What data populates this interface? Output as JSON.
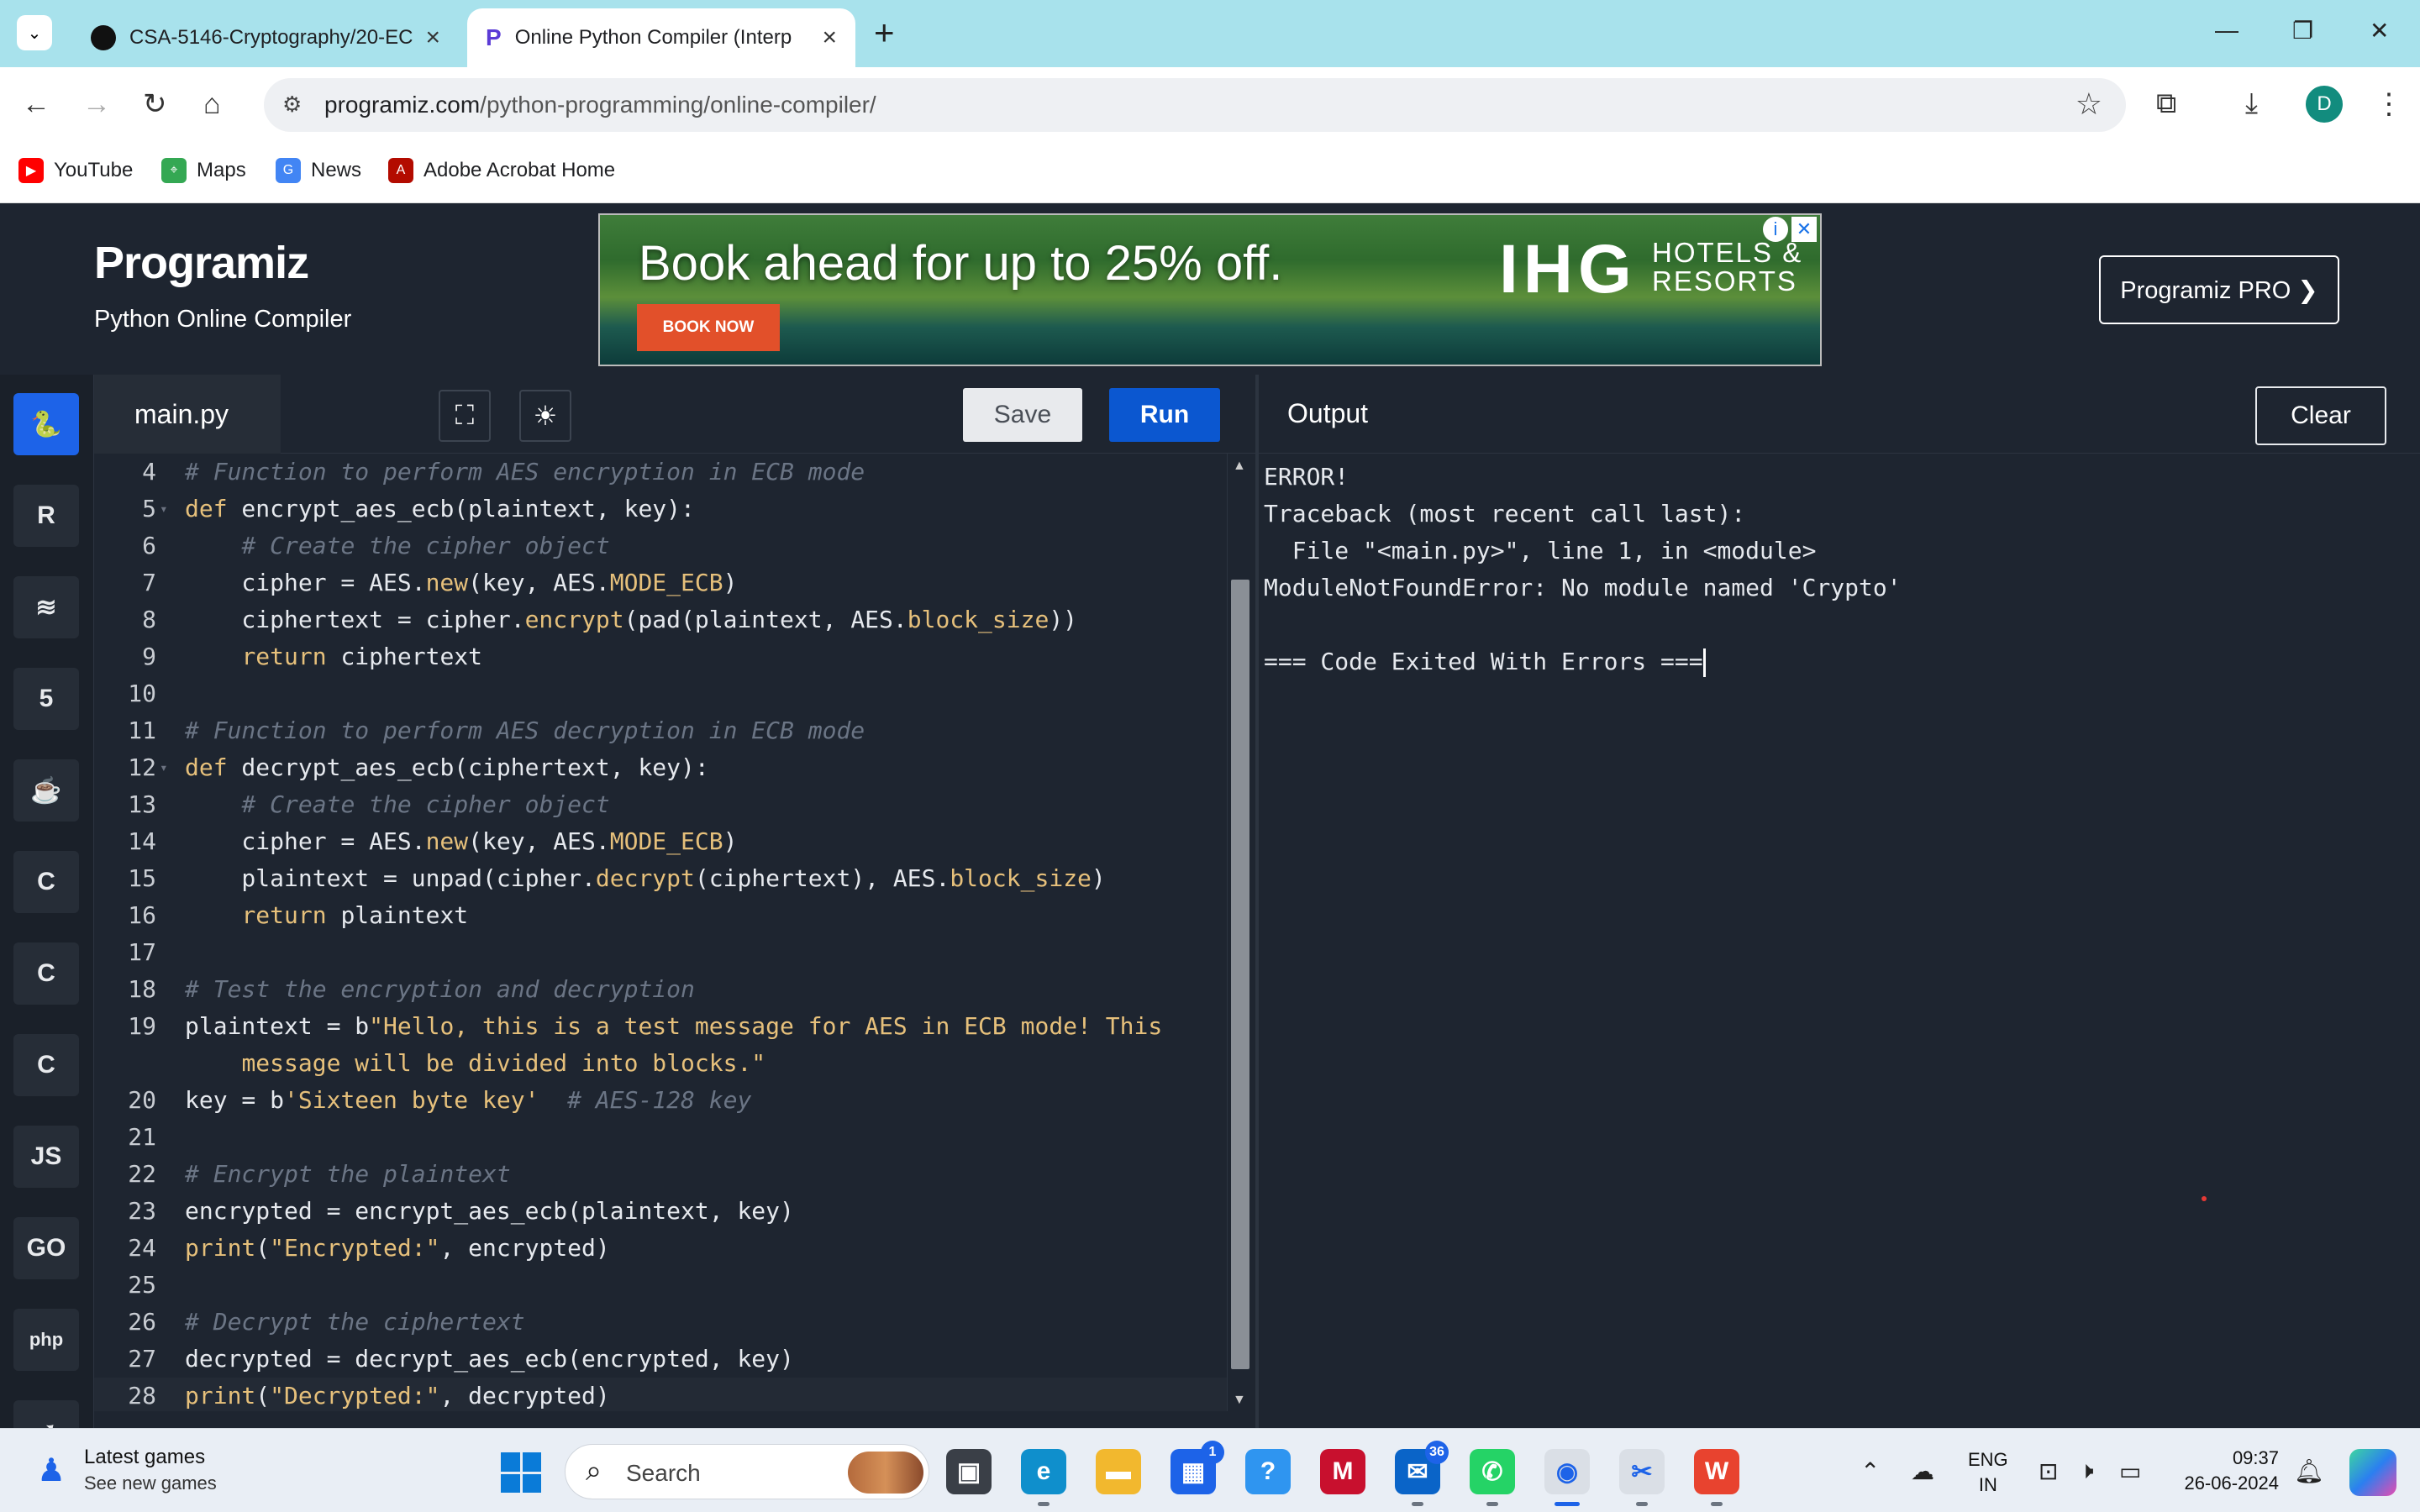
{
  "browser": {
    "tabs": [
      {
        "title": "CSA-5146-Cryptography/20-EC",
        "icon": "github-icon",
        "active": false
      },
      {
        "title": "Online Python Compiler (Interp",
        "icon": "programiz-icon",
        "active": true
      }
    ],
    "url_host": "programiz.com",
    "url_path": "/python-programming/online-compiler/",
    "profile_initial": "D",
    "bookmarks": [
      {
        "label": "YouTube",
        "icon": "youtube-icon",
        "color": "#ff0000"
      },
      {
        "label": "Maps",
        "icon": "maps-icon",
        "color": "#34a853"
      },
      {
        "label": "News",
        "icon": "news-icon",
        "color": "#4285f4"
      },
      {
        "label": "Adobe Acrobat Home",
        "icon": "acrobat-icon",
        "color": "#b30b00"
      }
    ]
  },
  "site": {
    "logo": "Programiz",
    "subtitle": "Python Online Compiler",
    "pro_button": "Programiz PRO ❯",
    "ad": {
      "headline": "Book ahead for up to 25% off.",
      "cta": "BOOK NOW",
      "brand": "IHG",
      "brand_line1": "HOTELS &",
      "brand_line2": "RESORTS"
    }
  },
  "sidebar": {
    "languages": [
      {
        "name": "python",
        "glyph": "🐍",
        "active": true
      },
      {
        "name": "r",
        "glyph": "R"
      },
      {
        "name": "sql",
        "glyph": "≋"
      },
      {
        "name": "html",
        "glyph": "5"
      },
      {
        "name": "java",
        "glyph": "☕"
      },
      {
        "name": "c",
        "glyph": "C"
      },
      {
        "name": "cpp",
        "glyph": "C"
      },
      {
        "name": "csharp",
        "glyph": "C"
      },
      {
        "name": "javascript",
        "glyph": "JS"
      },
      {
        "name": "go",
        "glyph": "GO"
      },
      {
        "name": "php",
        "glyph": "php"
      },
      {
        "name": "swift",
        "glyph": "➶"
      },
      {
        "name": "rust",
        "glyph": "⚙"
      }
    ]
  },
  "editor": {
    "file_name": "main.py",
    "save_label": "Save",
    "run_label": "Run",
    "lines": [
      {
        "n": "4",
        "fold": false,
        "html": "<span class='t-cm'># Function to perform AES encryption in ECB mode</span>"
      },
      {
        "n": "5",
        "fold": true,
        "html": "<span class='t-kw'>def</span> encrypt_aes_ecb(plaintext, key):"
      },
      {
        "n": "6",
        "fold": false,
        "html": "    <span class='t-cm'># Create the cipher object</span>"
      },
      {
        "n": "7",
        "fold": false,
        "html": "    cipher = AES.<span class='t-fn'>new</span>(key, AES.<span class='t-fn'>MODE_ECB</span>)"
      },
      {
        "n": "8",
        "fold": false,
        "html": "    ciphertext = cipher.<span class='t-fn'>encrypt</span>(pad(plaintext, AES.<span class='t-fn'>block_size</span>))"
      },
      {
        "n": "9",
        "fold": false,
        "html": "    <span class='t-kw'>return</span> ciphertext"
      },
      {
        "n": "10",
        "fold": false,
        "html": ""
      },
      {
        "n": "11",
        "fold": false,
        "html": "<span class='t-cm'># Function to perform AES decryption in ECB mode</span>"
      },
      {
        "n": "12",
        "fold": true,
        "html": "<span class='t-kw'>def</span> decrypt_aes_ecb(ciphertext, key):"
      },
      {
        "n": "13",
        "fold": false,
        "html": "    <span class='t-cm'># Create the cipher object</span>"
      },
      {
        "n": "14",
        "fold": false,
        "html": "    cipher = AES.<span class='t-fn'>new</span>(key, AES.<span class='t-fn'>MODE_ECB</span>)"
      },
      {
        "n": "15",
        "fold": false,
        "html": "    plaintext = unpad(cipher.<span class='t-fn'>decrypt</span>(ciphertext), AES.<span class='t-fn'>block_size</span>)"
      },
      {
        "n": "16",
        "fold": false,
        "html": "    <span class='t-kw'>return</span> plaintext"
      },
      {
        "n": "17",
        "fold": false,
        "html": ""
      },
      {
        "n": "18",
        "fold": false,
        "html": "<span class='t-cm'># Test the encryption and decryption</span>"
      },
      {
        "n": "19",
        "fold": false,
        "html": "plaintext = b<span class='t-str'>\"Hello, this is a test message for AES in ECB mode! This</span>"
      },
      {
        "n": "",
        "fold": false,
        "html": "    <span class='t-str'>message will be divided into blocks.\"</span>"
      },
      {
        "n": "20",
        "fold": false,
        "html": "key = b<span class='t-str'>'Sixteen byte key'</span>  <span class='t-cm'># AES-128 key</span>"
      },
      {
        "n": "21",
        "fold": false,
        "html": ""
      },
      {
        "n": "22",
        "fold": false,
        "html": "<span class='t-cm'># Encrypt the plaintext</span>"
      },
      {
        "n": "23",
        "fold": false,
        "html": "encrypted = encrypt_aes_ecb(plaintext, key)"
      },
      {
        "n": "24",
        "fold": false,
        "html": "<span class='t-kw'>print</span>(<span class='t-str'>\"Encrypted:\"</span>, encrypted)"
      },
      {
        "n": "25",
        "fold": false,
        "html": ""
      },
      {
        "n": "26",
        "fold": false,
        "html": "<span class='t-cm'># Decrypt the ciphertext</span>"
      },
      {
        "n": "27",
        "fold": false,
        "html": "decrypted = decrypt_aes_ecb(encrypted, key)"
      },
      {
        "n": "28",
        "fold": false,
        "html": "<span class='t-kw'>print</span>(<span class='t-str'>\"Decrypted:\"</span>, decrypted)",
        "current": true
      }
    ]
  },
  "output": {
    "title": "Output",
    "clear_label": "Clear",
    "lines": [
      "ERROR!",
      "Traceback (most recent call last):",
      "  File \"<main.py>\", line 1, in <module>",
      "ModuleNotFoundError: No module named 'Crypto'",
      "",
      "=== Code Exited With Errors ==="
    ]
  },
  "taskbar": {
    "widget_title": "Latest games",
    "widget_sub": "See new games",
    "search_placeholder": "Search",
    "apps": [
      {
        "name": "task-view",
        "glyph": "▣",
        "bg": "#3a3f47",
        "running": false
      },
      {
        "name": "edge",
        "glyph": "e",
        "bg": "#0f8fcc",
        "running": true
      },
      {
        "name": "file-explorer",
        "glyph": "▬",
        "bg": "#f2b82e",
        "running": false
      },
      {
        "name": "microsoft-store",
        "glyph": "▦",
        "bg": "#1d63e8",
        "badge": "1"
      },
      {
        "name": "help",
        "glyph": "?",
        "bg": "#2f95f0",
        "running": false
      },
      {
        "name": "mcafee",
        "glyph": "M",
        "bg": "#c8102e",
        "running": false
      },
      {
        "name": "outlook",
        "glyph": "✉",
        "bg": "#0a64c8",
        "badge": "36",
        "running": true
      },
      {
        "name": "whatsapp",
        "glyph": "✆",
        "bg": "#25d366",
        "running": true
      },
      {
        "name": "chrome",
        "glyph": "◉",
        "bg": "#dadfe6",
        "focused": true
      },
      {
        "name": "snipping-tool",
        "glyph": "✂",
        "bg": "#dadfe6",
        "running": true
      },
      {
        "name": "wps-office",
        "glyph": "W",
        "bg": "#e8432f",
        "running": true
      }
    ],
    "lang_line1": "ENG",
    "lang_line2": "IN",
    "time": "09:37",
    "date": "26-06-2024"
  }
}
